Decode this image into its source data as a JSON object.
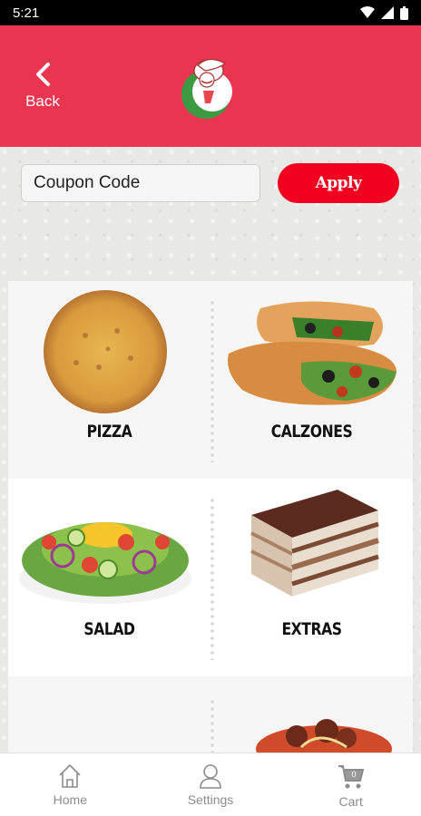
{
  "status_bar": {
    "time": "5:21"
  },
  "header": {
    "back_label": "Back"
  },
  "coupon": {
    "placeholder": "Coupon Code",
    "apply_label": "Apply"
  },
  "categories": [
    {
      "label": "PIZZA"
    },
    {
      "label": "CALZONES"
    },
    {
      "label": "SALAD"
    },
    {
      "label": "EXTRAS"
    },
    {
      "label": ""
    },
    {
      "label": ""
    }
  ],
  "nav": {
    "home": "Home",
    "settings": "Settings",
    "cart": "Cart",
    "cart_count": "0"
  },
  "colors": {
    "header": "#ea3550",
    "apply": "#f2001f"
  }
}
